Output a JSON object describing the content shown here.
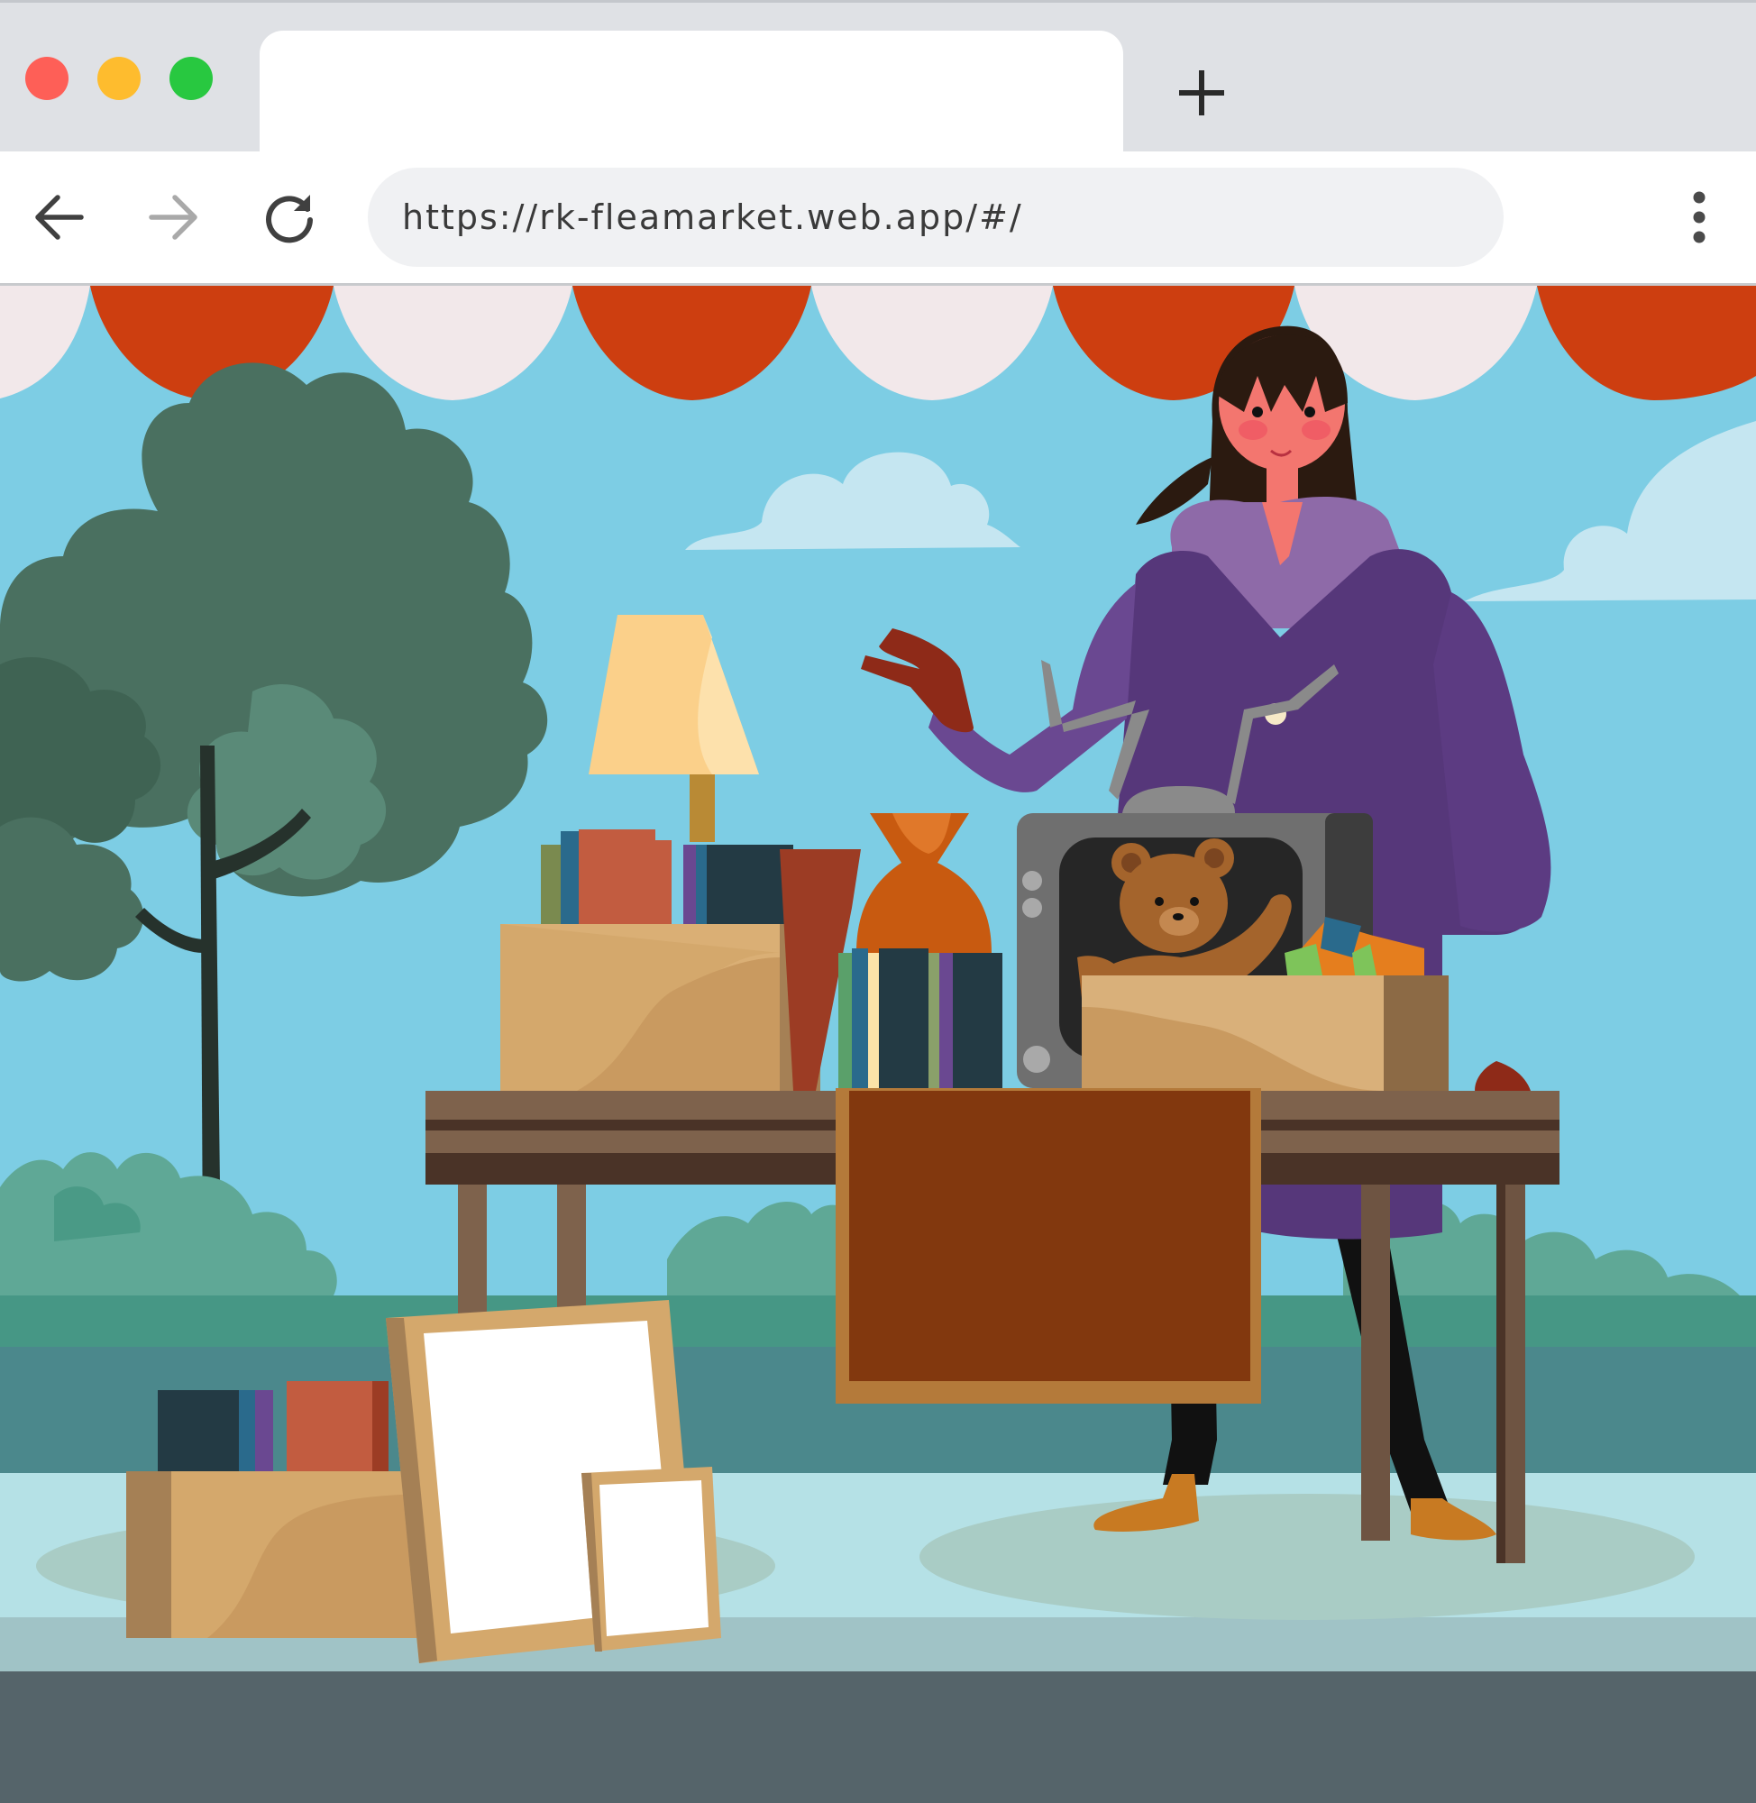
{
  "browser": {
    "tab": {
      "title": ""
    },
    "address_bar": {
      "url": "https://rk-fleamarket.web.app/#/"
    },
    "icons": {
      "back": "arrow-left-icon",
      "forward": "arrow-right-icon",
      "reload": "reload-icon",
      "new_tab": "plus-icon",
      "menu": "kebab-menu-icon"
    }
  },
  "colors": {
    "window_close": "#fe5f57",
    "window_minimize": "#febc2e",
    "window_maximize": "#28c840",
    "sky": "#7dcde4",
    "awning_red": "#cd3e10",
    "awning_white": "#f2e8ea",
    "coat_purple": "#56377a"
  },
  "page": {
    "illustration": "flea-market-illustration"
  }
}
